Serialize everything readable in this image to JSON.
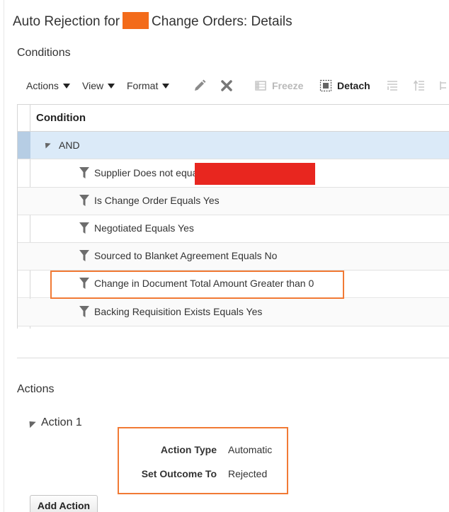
{
  "page": {
    "title_prefix": "Auto Rejection for",
    "title_suffix": "Change Orders: Details"
  },
  "conditions": {
    "heading": "Conditions",
    "toolbar": {
      "actions_label": "Actions",
      "view_label": "View",
      "format_label": "Format",
      "edit_icon": "pencil-icon",
      "delete_icon": "x-icon",
      "freeze_label": "Freeze",
      "detach_label": "Detach",
      "extra_icons": [
        "wrap-icon",
        "move-up-icon",
        "expand-icon"
      ]
    },
    "table": {
      "column_header": "Condition",
      "group_label": "AND",
      "rows": [
        {
          "text": "Supplier Does not equal"
        },
        {
          "text": "Is Change Order Equals Yes"
        },
        {
          "text": "Negotiated Equals Yes"
        },
        {
          "text": "Sourced to Blanket Agreement Equals No"
        },
        {
          "text": "Change in Document Total Amount Greater than 0"
        },
        {
          "text": "Backing Requisition Exists Equals Yes"
        }
      ],
      "condition_icon": "filter-icon"
    }
  },
  "actions": {
    "heading": "Actions",
    "items": [
      {
        "label": "Action 1",
        "fields": [
          {
            "label": "Action Type",
            "value": "Automatic"
          },
          {
            "label": "Set Outcome To",
            "value": "Rejected"
          }
        ]
      }
    ],
    "add_button": "Add Action"
  },
  "colors": {
    "highlight": "#f17a35",
    "selected_row": "#dbeaf8",
    "redaction_orange": "#f36b1a",
    "redaction_red": "#e8261f"
  }
}
